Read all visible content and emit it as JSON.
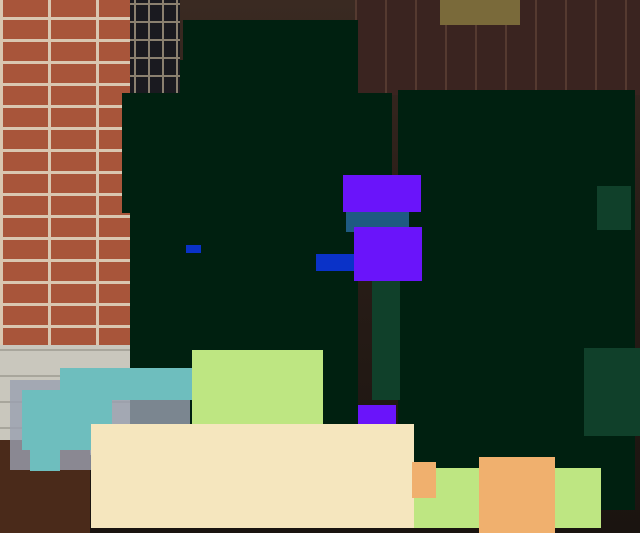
{
  "scene": {
    "colors": {
      "person_mask": "#002010",
      "dark_teal_mask": "#10402a",
      "purple_mask": "#6a14fa",
      "blue_mask": "#0a32c8",
      "steel_blue_mask": "#1e5a82",
      "light_green_mask": "#bee682",
      "cream_mask": "#f5e6be",
      "orange_mask": "#f0b06e",
      "cyan_mask": "#6ebebe"
    }
  }
}
